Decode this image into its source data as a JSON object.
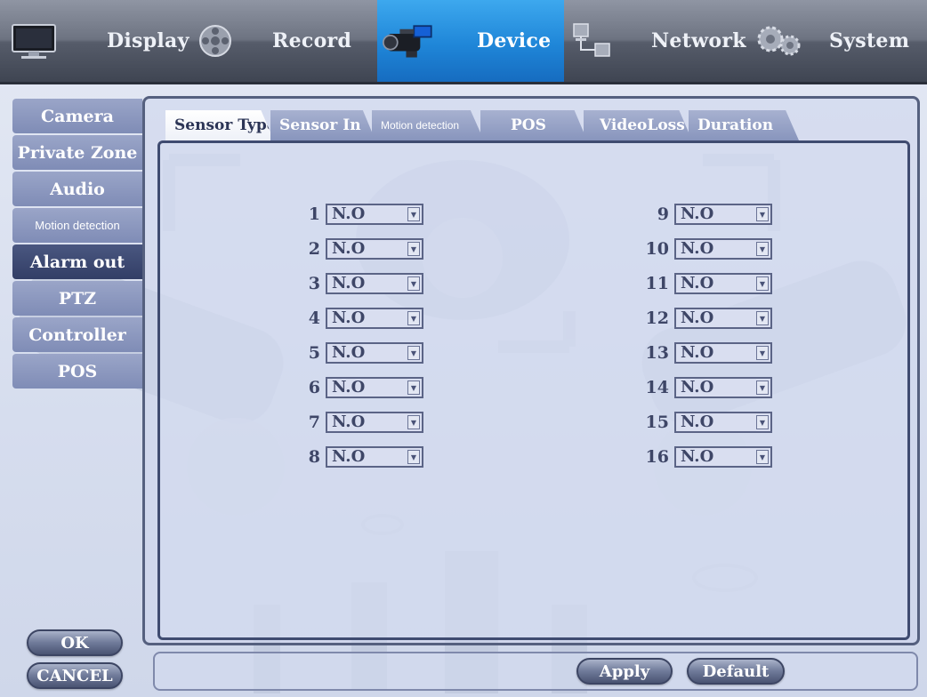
{
  "top_nav": {
    "items": [
      {
        "label": "Display",
        "icon": "monitor-icon",
        "active": false
      },
      {
        "label": "Record",
        "icon": "film-reel-icon",
        "active": false
      },
      {
        "label": "Device",
        "icon": "video-camera-icon",
        "active": true
      },
      {
        "label": "Network",
        "icon": "network-computers-icon",
        "active": false
      },
      {
        "label": "System",
        "icon": "gears-icon",
        "active": false
      }
    ]
  },
  "side_menu": {
    "items": [
      {
        "label": "Camera",
        "active": false
      },
      {
        "label": "Private Zone",
        "active": false
      },
      {
        "label": "Audio",
        "active": false
      },
      {
        "label": "Motion detection",
        "active": false
      },
      {
        "label": "Alarm out",
        "active": true
      },
      {
        "label": "PTZ",
        "active": false
      },
      {
        "label": "Controller",
        "active": false
      },
      {
        "label": "POS",
        "active": false
      }
    ]
  },
  "tabs": [
    {
      "label": "Sensor Type",
      "active": true
    },
    {
      "label": "Sensor In",
      "active": false
    },
    {
      "label": "Motion detection",
      "active": false
    },
    {
      "label": "POS",
      "active": false
    },
    {
      "label": "VideoLoss",
      "active": false
    },
    {
      "label": "Duration",
      "active": false
    }
  ],
  "sensors": {
    "left": [
      {
        "num": "1",
        "value": "N.O"
      },
      {
        "num": "2",
        "value": "N.O"
      },
      {
        "num": "3",
        "value": "N.O"
      },
      {
        "num": "4",
        "value": "N.O"
      },
      {
        "num": "5",
        "value": "N.O"
      },
      {
        "num": "6",
        "value": "N.O"
      },
      {
        "num": "7",
        "value": "N.O"
      },
      {
        "num": "8",
        "value": "N.O"
      }
    ],
    "right": [
      {
        "num": "9",
        "value": "N.O"
      },
      {
        "num": "10",
        "value": "N.O"
      },
      {
        "num": "11",
        "value": "N.O"
      },
      {
        "num": "12",
        "value": "N.O"
      },
      {
        "num": "13",
        "value": "N.O"
      },
      {
        "num": "14",
        "value": "N.O"
      },
      {
        "num": "15",
        "value": "N.O"
      },
      {
        "num": "16",
        "value": "N.O"
      }
    ],
    "dropdown_icon": "dropdown-arrow-icon"
  },
  "buttons": {
    "ok": "OK",
    "cancel": "CANCEL",
    "apply": "Apply",
    "default": "Default"
  },
  "colors": {
    "active_tab_blue": "#1f86d8",
    "menu_active": "#323e66",
    "menu_item": "#7f8cb6",
    "panel_border": "#3f4b70"
  }
}
